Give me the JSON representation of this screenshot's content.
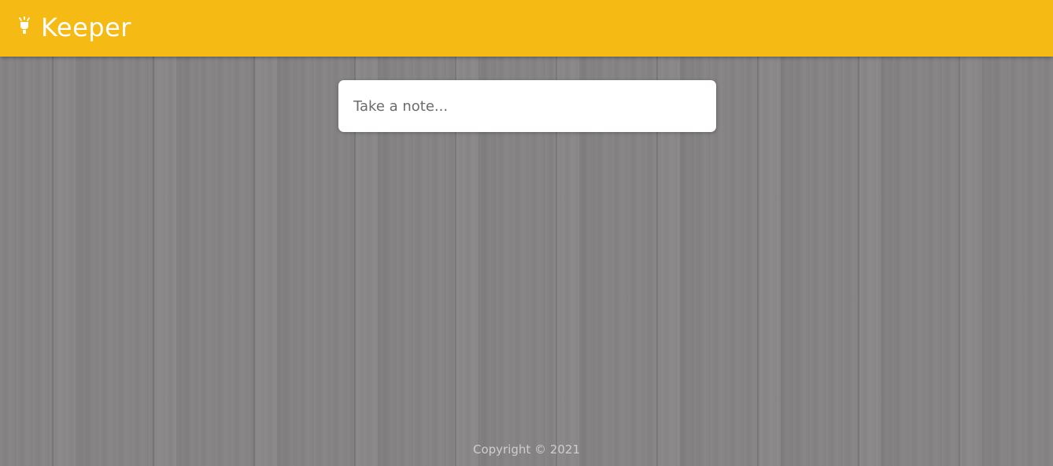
{
  "header": {
    "app_title": "Keeper",
    "logo_icon": "lightbulb-icon",
    "color": "#f5ba13"
  },
  "note_form": {
    "placeholder": "Take a note..."
  },
  "footer": {
    "copyright": "Copyright © 2021"
  }
}
